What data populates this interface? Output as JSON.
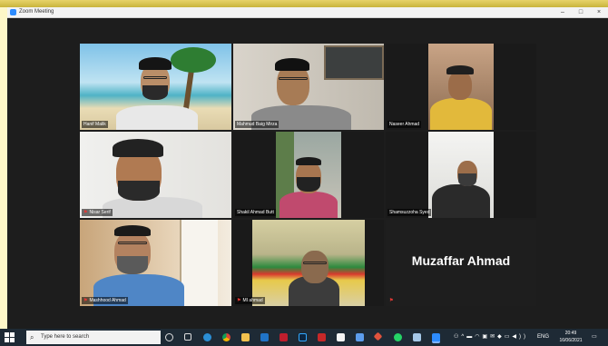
{
  "window": {
    "title": "Zoom Meeting",
    "controls": {
      "minimize": "–",
      "maximize": "□",
      "close": "×"
    }
  },
  "participants": [
    {
      "name": "Hanif Malik",
      "muted": false,
      "active_speaker": true
    },
    {
      "name": "Mahmud Baig Mirza",
      "muted": false,
      "active_speaker": false
    },
    {
      "name": "Naseer Ahmad",
      "muted": false,
      "active_speaker": false
    },
    {
      "name": "Nisar Serif",
      "muted": true,
      "active_speaker": false
    },
    {
      "name": "Shakil Ahmad Butt",
      "muted": false,
      "active_speaker": false
    },
    {
      "name": "Shamsuzzoha Syed",
      "muted": false,
      "active_speaker": false
    },
    {
      "name": "Mashhood Ahmad",
      "muted": true,
      "active_speaker": false
    },
    {
      "name": "MI ahmad",
      "muted": true,
      "active_speaker": false
    },
    {
      "name": "Muzaffar Ahmad",
      "muted": true,
      "active_speaker": false,
      "video_off": true
    }
  ],
  "muted_icon": "muted-mic-icon",
  "taskbar": {
    "search_placeholder": "Type here to search",
    "language": "ENG",
    "time": "20:49",
    "date": "16/06/2021"
  },
  "colors": {
    "active_speaker_border": "#c7d533",
    "meeting_background": "#1d1d1d",
    "taskbar": "#1e2a35",
    "mute_indicator": "#e53935"
  }
}
